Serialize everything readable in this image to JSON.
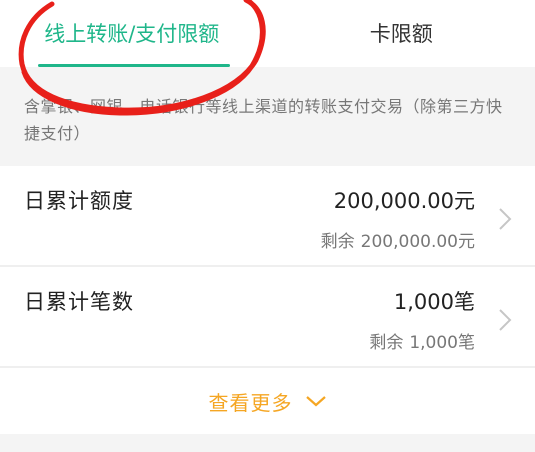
{
  "tabs": [
    {
      "label": "线上转账/支付限额",
      "active": true
    },
    {
      "label": "卡限额",
      "active": false
    }
  ],
  "description": "含掌银、网银、电话银行等线上渠道的转账支付交易（除第三方快捷支付）",
  "limits": [
    {
      "label": "日累计额度",
      "value": "200,000.00元",
      "remaining_label": "剩余",
      "remaining_value": "200,000.00元"
    },
    {
      "label": "日累计笔数",
      "value": "1,000笔",
      "remaining_label": "剩余",
      "remaining_value": "1,000笔"
    }
  ],
  "view_more": {
    "label": "查看更多",
    "icon": "chevron-down-icon"
  },
  "colors": {
    "accent": "#1fb68a",
    "more": "#f5a623",
    "annotation": "#e8201a"
  }
}
